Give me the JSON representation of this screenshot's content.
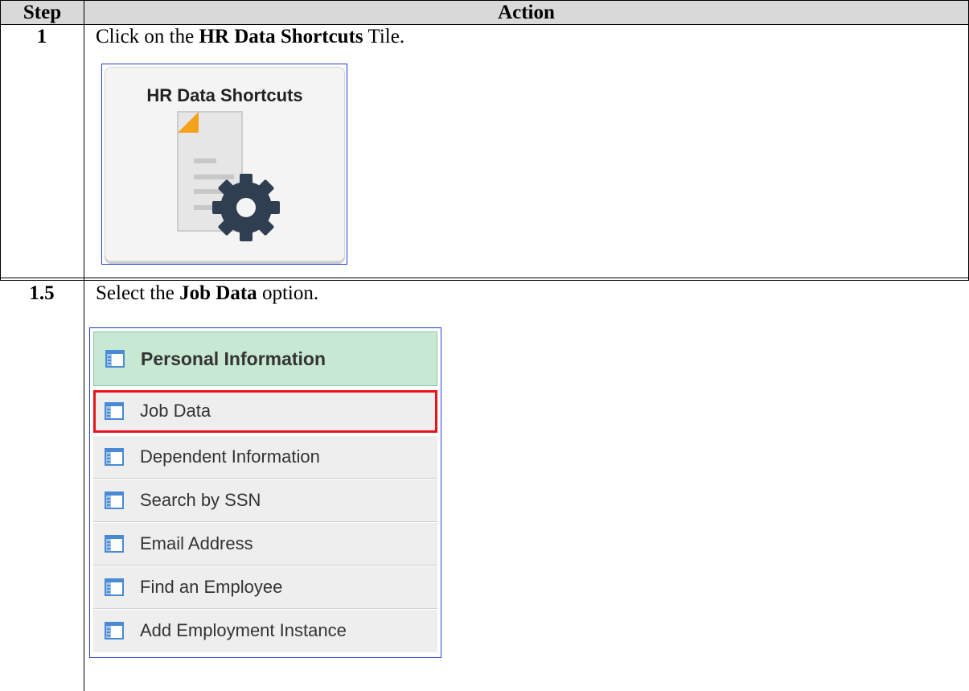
{
  "table": {
    "headers": {
      "step": "Step",
      "action": "Action"
    },
    "rows": [
      {
        "step": "1",
        "text_before": "Click on the ",
        "text_bold": "HR Data Shortcuts",
        "text_after": " Tile.",
        "tile": {
          "title": "HR Data Shortcuts",
          "icon": "document-gear-icon"
        }
      },
      {
        "step": "1.5",
        "text_before": "Select the ",
        "text_bold": "Job Data",
        "text_after": " option.",
        "menu": {
          "header": "Personal Information",
          "items": [
            {
              "label": "Job Data",
              "highlighted": true
            },
            {
              "label": "Dependent Information"
            },
            {
              "label": "Search by SSN"
            },
            {
              "label": "Email Address"
            },
            {
              "label": "Find an Employee"
            },
            {
              "label": "Add Employment Instance"
            }
          ],
          "highlight_color": "#e8141c",
          "header_color": "#c7e8d2"
        }
      }
    ]
  }
}
